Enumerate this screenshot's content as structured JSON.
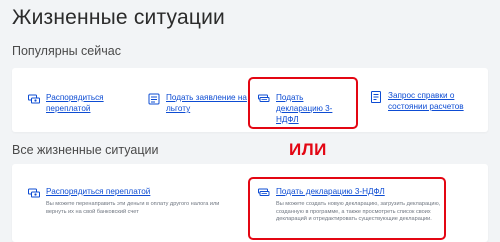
{
  "page_title": "Жизненные ситуации",
  "popular": {
    "title": "Популярны сейчас",
    "items": [
      {
        "label": "Распорядиться переплатой",
        "icon": "currency-exchange-icon"
      },
      {
        "label": "Подать заявление на льготу",
        "icon": "application-form-icon"
      },
      {
        "label": "Подать декларацию 3-НДФЛ",
        "icon": "declaration-stack-icon"
      },
      {
        "label": "Запрос справки о состоянии расчетов",
        "icon": "document-list-icon"
      }
    ]
  },
  "all": {
    "title": "Все жизненные ситуации",
    "items": [
      {
        "label": "Распорядиться переплатой",
        "icon": "currency-exchange-icon",
        "description": "Вы можете перенаправить эти деньги в оплату другого налога или вернуть их на свой банковский счет"
      },
      {
        "label": "Подать декларацию 3-НДФЛ",
        "icon": "declaration-stack-icon",
        "description": "Вы можете создать новую декларацию, загрузить декларацию, созданную в программе, а также просмотреть список своих деклараций и отредактировать существующие декларации."
      }
    ]
  },
  "annotation": {
    "or_label": "ИЛИ",
    "color": "#e30613"
  },
  "colors": {
    "link": "#0d4cd3",
    "background": "#f2f4f6"
  }
}
